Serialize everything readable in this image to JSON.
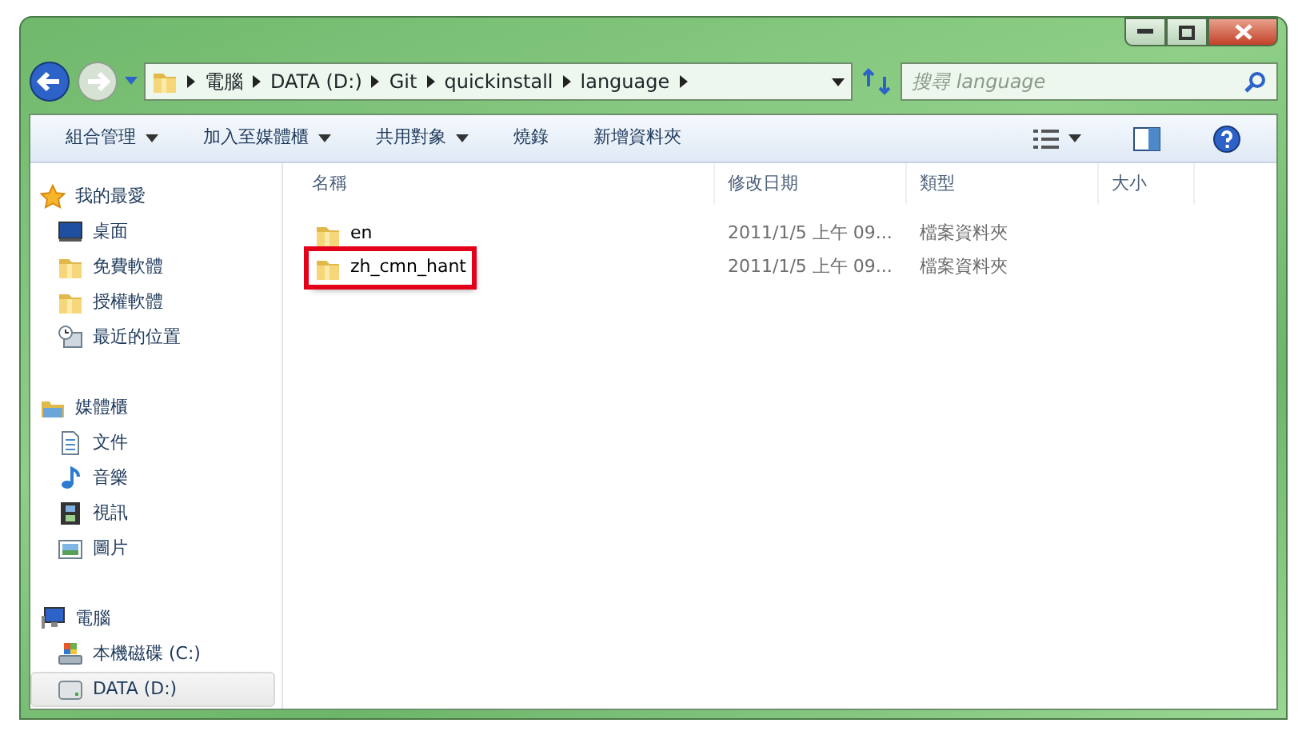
{
  "address": {
    "crumbs": [
      "電腦",
      "DATA (D:)",
      "Git",
      "quickinstall",
      "language"
    ]
  },
  "search": {
    "placeholder": "搜尋 language"
  },
  "toolbar": {
    "items": [
      {
        "label": "組合管理",
        "dropdown": true
      },
      {
        "label": "加入至媒體櫃",
        "dropdown": true
      },
      {
        "label": "共用對象",
        "dropdown": true
      },
      {
        "label": "燒錄",
        "dropdown": false
      },
      {
        "label": "新增資料夾",
        "dropdown": false
      }
    ]
  },
  "sidebar": {
    "groups": [
      {
        "label": "我的最愛",
        "children": [
          {
            "label": "桌面",
            "selected": false
          },
          {
            "label": "免費軟體",
            "selected": false
          },
          {
            "label": "授權軟體",
            "selected": false
          },
          {
            "label": "最近的位置",
            "selected": false
          }
        ]
      },
      {
        "label": "媒體櫃",
        "children": [
          {
            "label": "文件",
            "selected": false
          },
          {
            "label": "音樂",
            "selected": false
          },
          {
            "label": "視訊",
            "selected": false
          },
          {
            "label": "圖片",
            "selected": false
          }
        ]
      },
      {
        "label": "電腦",
        "children": [
          {
            "label": "本機磁碟 (C:)",
            "selected": false
          },
          {
            "label": "DATA (D:)",
            "selected": true
          }
        ]
      }
    ]
  },
  "table": {
    "columns": [
      "名稱",
      "修改日期",
      "類型",
      "大小"
    ],
    "rows": [
      {
        "name": "en",
        "modified": "2011/1/5 上午 09...",
        "type": "檔案資料夾",
        "highlighted": false
      },
      {
        "name": "zh_cmn_hant",
        "modified": "2011/1/5 上午 09...",
        "type": "檔案資料夾",
        "highlighted": true
      }
    ]
  }
}
